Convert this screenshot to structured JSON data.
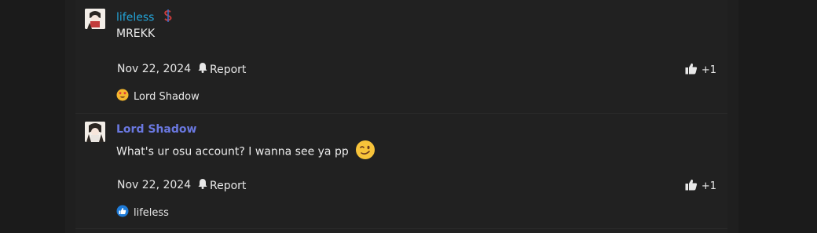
{
  "comments": [
    {
      "author": "lifeless",
      "author_color": "#23a4d8",
      "badge_icon": "dollar-sign-icon",
      "text": "MREKK",
      "emoji": "",
      "date": "Nov 22, 2024",
      "report_label": "Report",
      "like_count": "+1",
      "reaction_icon": "heart-eyes-emoji-icon",
      "reaction_user": "Lord Shadow"
    },
    {
      "author": "Lord Shadow",
      "author_color": "#6a78e0",
      "text": "What's ur osu account? I wanna see ya pp",
      "emoji": "winking-face-emoji-icon",
      "date": "Nov 22, 2024",
      "report_label": "Report",
      "like_count": "+1",
      "reaction_icon": "thumbs-up-reaction-icon",
      "reaction_user": "lifeless"
    }
  ]
}
